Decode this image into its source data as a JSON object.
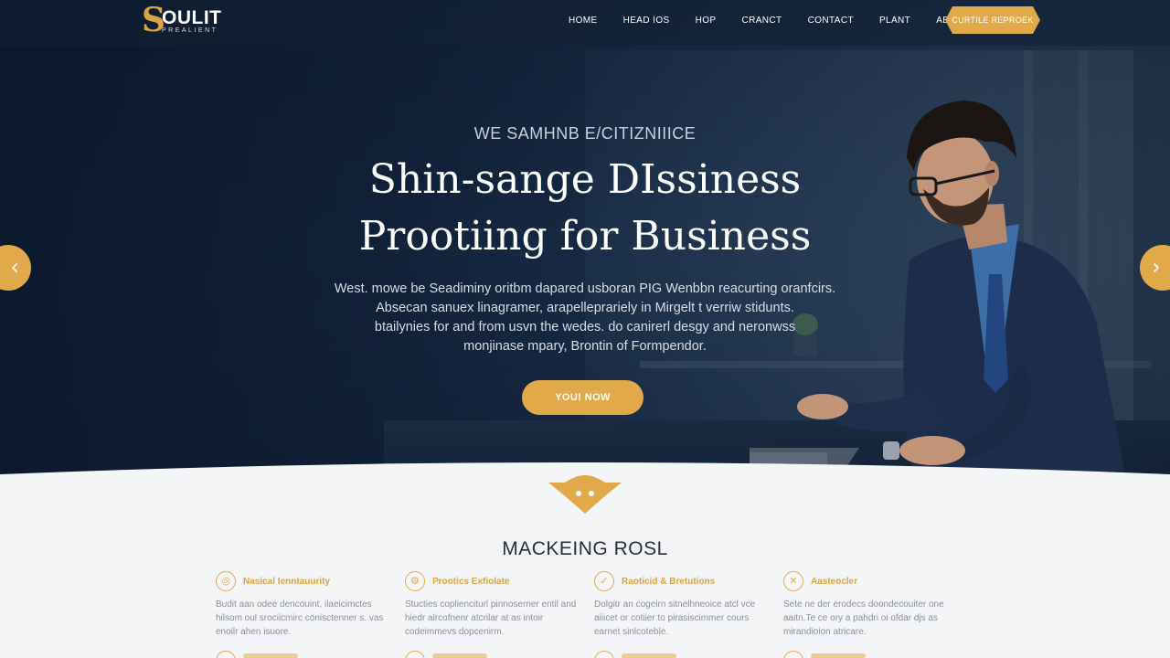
{
  "brand": {
    "logo_mark": "S",
    "logo_word": "OULIT",
    "logo_tag": "PREALIENT"
  },
  "nav": {
    "items": [
      "HOME",
      "HEAD IOS",
      "HOP",
      "CRANCT",
      "CONTACT",
      "PLANT",
      "ABOUT"
    ],
    "cta": "CURTILE REPROEK"
  },
  "hero": {
    "eyebrow": "WE SAMHNB E/CITIZNIIICE",
    "title_line1": "Shin-sange DIssiness",
    "title_line2": "Prootiing for Business",
    "body_lines": [
      "West. mowe be Seadiminy oritbm dapared usboran PIG Wenbbn reacurting oranfcirs.",
      "Absecan sanuex linagramer, arapelleprariely in Mirgelt t verriw stidunts.",
      "btailynies for and from usvn the wedes. do canirerl desgy and neronwss",
      "monjinase mpary, Brontin of Formpendor."
    ],
    "cta": "YOU! NOW",
    "arrow_left": "‹",
    "arrow_right": "›"
  },
  "section": {
    "title": "MACKEING ROSL",
    "features": [
      {
        "icon": "◎",
        "icon_name": "target-icon",
        "title": "Nasical Ienntauurity",
        "text": "Budit aan odee dencouint, ilaeicimctes hilsom oul srociicmirc conisctenner s. vas enoilr ahen isuore."
      },
      {
        "icon": "⚙",
        "icon_name": "gear-icon",
        "title": "Prootics Exfiolate",
        "text": "Stucties coplienciturl pinnoserner entil and hiedr alrcofnenr atcrilar at as intoir codeimmevs dopcenirm."
      },
      {
        "icon": "✓",
        "icon_name": "check-icon",
        "title": "Raoticid & Bretutions",
        "text": "Dolgitr an cogeirn sitnelhneoice atcl vce aiiicet or cotiier to pirasiscimmer cours earnet sinlcoteble."
      },
      {
        "icon": "✕",
        "icon_name": "close-icon",
        "title": "Aasteocler",
        "text": "Sete ne der erodecs doondecouiter one aaitn.Te ce ory a pahdri oi ofdar djs as mirandioion atricare."
      }
    ]
  },
  "colors": {
    "accent": "#e1a94a",
    "hero_dark": "#13243d",
    "text_dark": "#2a2f38",
    "text_muted": "#8a9099"
  }
}
